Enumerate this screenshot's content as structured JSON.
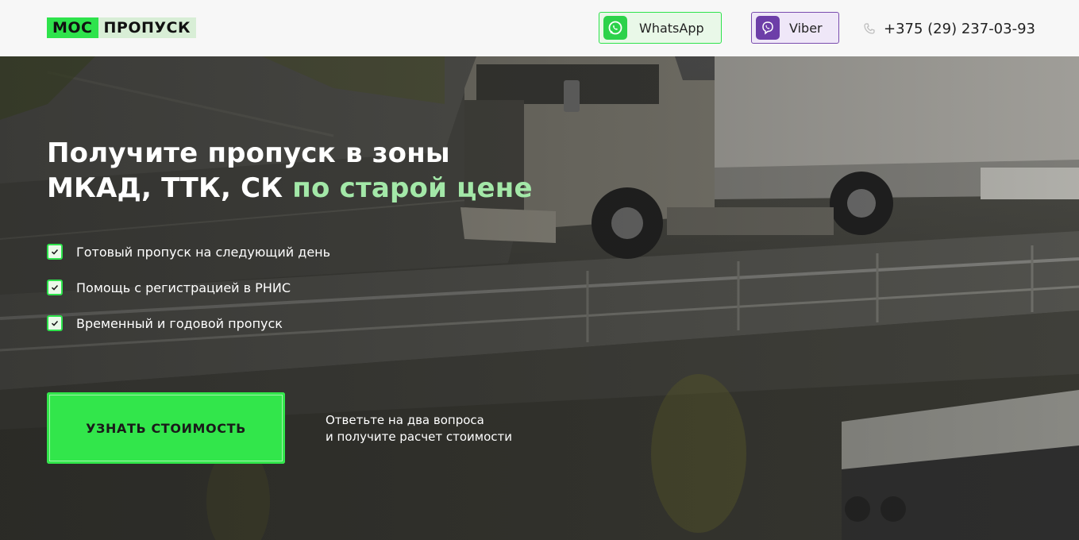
{
  "header": {
    "logo": {
      "part1": "МОС",
      "part2": "ПРОПУСК"
    },
    "whatsapp_label": "WhatsApp",
    "viber_label": "Viber",
    "phone": "+375 (29) 237-03-93"
  },
  "hero": {
    "headline_line1": "Получите пропуск в зоны",
    "headline_line2_plain": "МКАД, ТТК, СК ",
    "headline_line2_accent": "по старой цене",
    "features": [
      "Готовый пропуск на следующий день",
      "Помощь с регистрацией в РНИС",
      "Временный и годовой пропуск"
    ],
    "cta_label": "УЗНАТЬ СТОИМОСТЬ",
    "cta_note_line1": "Ответьте на два вопроса",
    "cta_note_line2": "и получите расчет стоимости"
  },
  "colors": {
    "brand_green": "#2ee34c",
    "accent_text_green": "#a3e8a8",
    "viber_purple": "#6d3ea8"
  },
  "icons": [
    "whatsapp-icon",
    "viber-icon",
    "phone-icon",
    "check-icon"
  ]
}
